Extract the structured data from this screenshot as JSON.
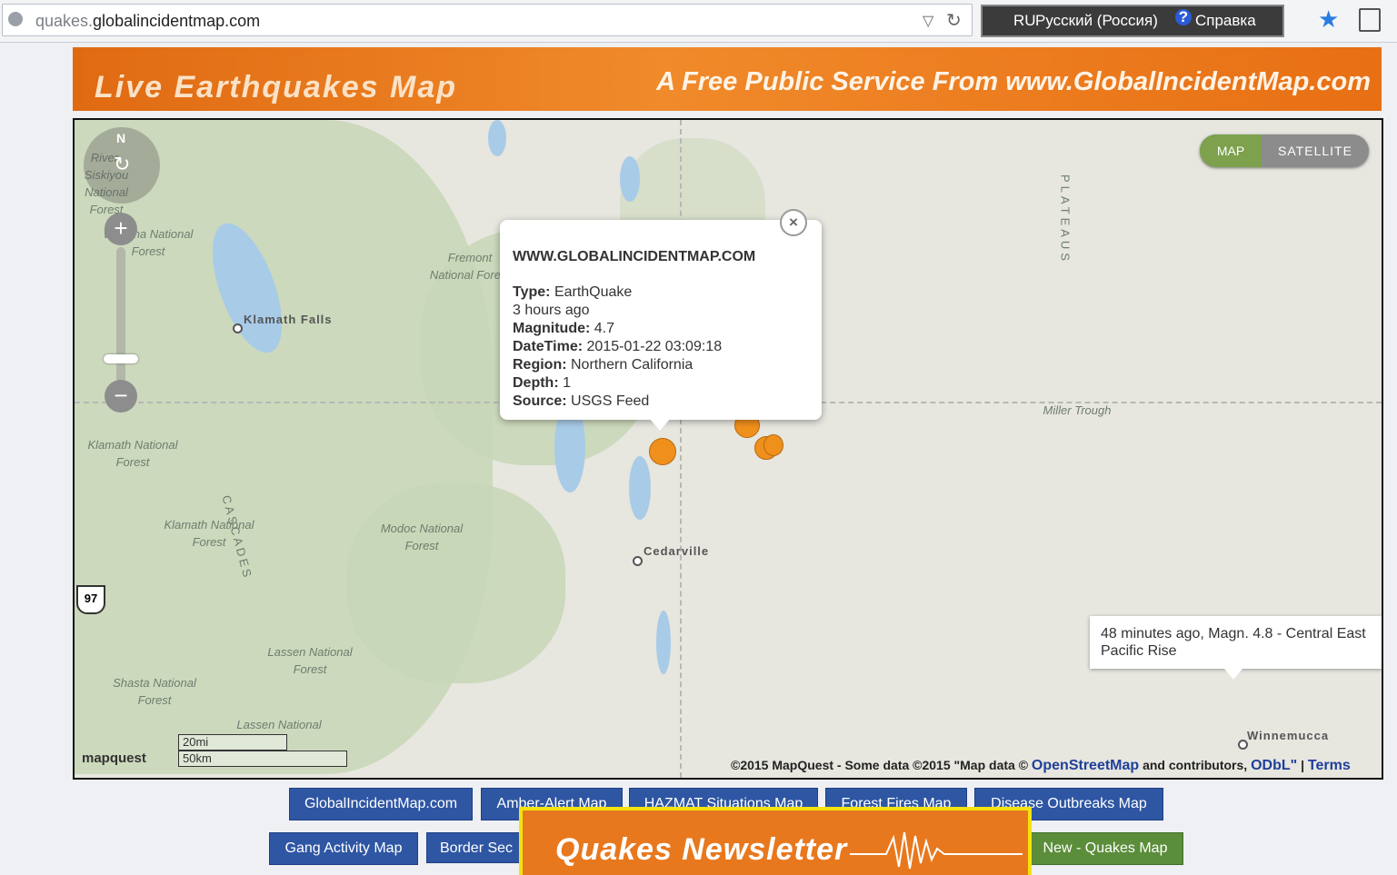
{
  "browser": {
    "url_prefix": "quakes.",
    "url_domain": "globalincidentmap.com",
    "lang_code": "RU",
    "lang_name": "Русский (Россия)",
    "help_label": "Справка"
  },
  "banner": {
    "title": "Live Earthquakes Map",
    "tagline": "A Free Public Service From www.GlobalIncidentMap.com"
  },
  "map": {
    "compass_n": "N",
    "zoom_in": "+",
    "zoom_out": "−",
    "toggle": {
      "map": "MAP",
      "satellite": "SATELLITE"
    },
    "labels": {
      "winema": "Winema National Forest",
      "fremont": "Fremont National Forest",
      "klamath1": "Klamath National Forest",
      "klamath2": "Klamath National Forest",
      "modoc": "Modoc National Forest",
      "lassen1": "Lassen National Forest",
      "lassen2": "Lassen National",
      "shasta": "Shasta National Forest",
      "siskiyou": "River-Siskiyou National Forest",
      "plateaus": "PLATEAUS",
      "miller": "Miller Trough",
      "cascades": "CASCADES"
    },
    "cities": {
      "klamath_falls": "Klamath Falls",
      "cedarville": "Cedarville",
      "winnemucca": "Winnemucca"
    },
    "highway": "97",
    "popup": {
      "heading": "WWW.GLOBALINCIDENTMAP.COM",
      "type_label": "Type:",
      "type_value": "EarthQuake",
      "age": "3 hours ago",
      "magnitude_label": "Magnitude:",
      "magnitude_value": "4.7",
      "datetime_label": "DateTime:",
      "datetime_value": "2015-01-22 03:09:18",
      "region_label": "Region:",
      "region_value": "Northern California",
      "depth_label": "Depth:",
      "depth_value": "1",
      "source_label": "Source:",
      "source_value": "USGS Feed"
    },
    "tooltip": "48 minutes ago, Magn. 4.8 - Central East Pacific Rise",
    "scale_mi": "20mi",
    "scale_km": "50km",
    "logo": "mapquest",
    "attribution": {
      "prefix": "©2015 MapQuest  -  Some data ©2015 \"Map data ©",
      "osm": "OpenStreetMap",
      "contrib": "and contributors,",
      "odbl": "ODbL\"",
      "sep": "|",
      "terms": "Terms"
    }
  },
  "nav": {
    "row1": [
      "GlobalIncidentMap.com",
      "Amber-Alert Map",
      "HAZMAT Situations Map",
      "Forest Fires Map",
      "Disease Outbreaks Map"
    ],
    "row2": [
      "Gang Activity Map",
      "Border Sec",
      "New - Quakes Map"
    ]
  },
  "newsletter": "Quakes Newsletter",
  "colors": {
    "accent_orange": "#e8781e",
    "nav_blue": "#2e56a3",
    "nav_green": "#5b8d3a",
    "quake_marker": "#f0901c"
  }
}
